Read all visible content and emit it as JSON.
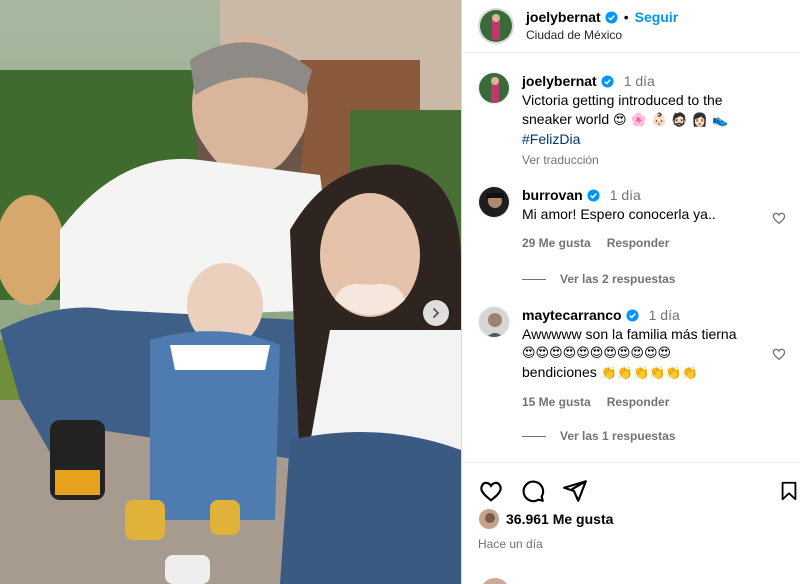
{
  "post": {
    "author": "joelybernat",
    "follow_label": "Seguir",
    "location": "Ciudad de México",
    "separator": "•"
  },
  "caption": {
    "author": "joelybernat",
    "time": "1 día",
    "text_line1": "Victoria getting introduced to the",
    "text_line2": "sneaker world",
    "emojis": "😍 🌸 👶🏻 🧔🏻 👩🏻 👟",
    "hashtag": "#FelizDia",
    "translate_label": "Ver traducción"
  },
  "comments": [
    {
      "author": "burrovan",
      "time": "1 día",
      "text": "Mi amor! Espero conocerla ya..",
      "likes": "29 Me gusta",
      "reply_label": "Responder",
      "view_replies": "Ver las 2 respuestas"
    },
    {
      "author": "maytecarranco",
      "time": "1 día",
      "text": "Awwwww son la familia más tierna",
      "emoji_row": "😍😍😍😍😍😍😍😍😍😍😍",
      "text2": "bendiciones",
      "emoji_row2": "👏👏👏👏👏👏",
      "likes": "15 Me gusta",
      "reply_label": "Responder",
      "view_replies": "Ver las 1 respuestas"
    }
  ],
  "footer": {
    "likes_count": "36.961 Me gusta",
    "date": "Hace un día"
  },
  "icons": {
    "heart": "heart-icon",
    "comment": "comment-icon",
    "share": "share-icon",
    "save": "bookmark-icon",
    "verified": "verified-badge-icon",
    "next": "chevron-right-icon"
  },
  "colors": {
    "accent": "#0095f6",
    "verified": "#0095f6",
    "muted": "#737373",
    "hashtag": "#00376b"
  }
}
